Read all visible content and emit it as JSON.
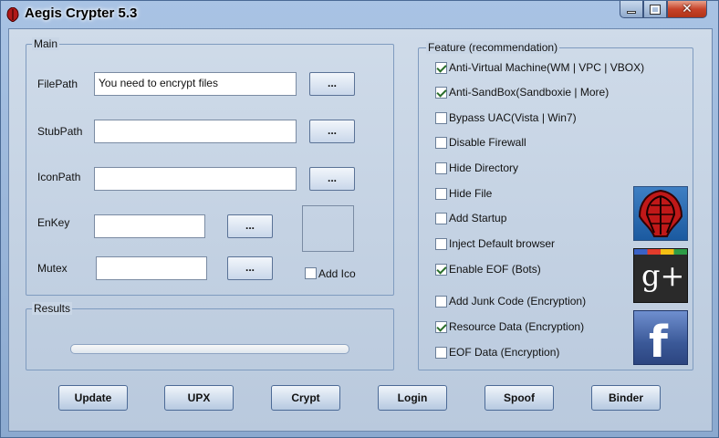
{
  "window": {
    "title": "Aegis Crypter 5.3",
    "close_glyph": "✕"
  },
  "main": {
    "legend": "Main",
    "filepath_label": "FilePath",
    "filepath_value": "You need to encrypt files",
    "stubpath_label": "StubPath",
    "stubpath_value": "",
    "iconpath_label": "IconPath",
    "iconpath_value": "",
    "enkey_label": "EnKey",
    "enkey_value": "",
    "mutex_label": "Mutex",
    "mutex_value": "",
    "browse_label": "...",
    "add_ico_label": "Add Ico",
    "add_ico_checked": false
  },
  "results": {
    "legend": "Results",
    "progress": 0
  },
  "feature": {
    "legend": "Feature (recommendation)",
    "items": [
      {
        "label": "Anti-Virtual Machine(WM | VPC | VBOX)",
        "checked": true
      },
      {
        "label": "Anti-SandBox(Sandboxie | More)",
        "checked": true
      },
      {
        "label": "Bypass UAC(Vista | Win7)",
        "checked": false
      },
      {
        "label": "Disable Firewall",
        "checked": false
      },
      {
        "label": "Hide Directory",
        "checked": false
      },
      {
        "label": "Hide File",
        "checked": false
      },
      {
        "label": "Add Startup",
        "checked": false
      },
      {
        "label": "Inject Default browser",
        "checked": false
      },
      {
        "label": "Enable EOF (Bots)",
        "checked": true
      },
      {
        "label": "Add Junk Code (Encryption)",
        "checked": false
      },
      {
        "label": "Resource Data (Encryption)",
        "checked": true
      },
      {
        "label": "EOF Data (Encryption)",
        "checked": false
      }
    ]
  },
  "social": {
    "gplus_text": "g+",
    "fb_text": "f"
  },
  "buttons": {
    "update": "Update",
    "upx": "UPX",
    "crypt": "Crypt",
    "login": "Login",
    "spoof": "Spoof",
    "binder": "Binder"
  },
  "colors": {
    "accent": "#8ba9cf",
    "checkmark": "#2a6e2a",
    "facebook": "#3b5998",
    "close": "#c7432a"
  }
}
